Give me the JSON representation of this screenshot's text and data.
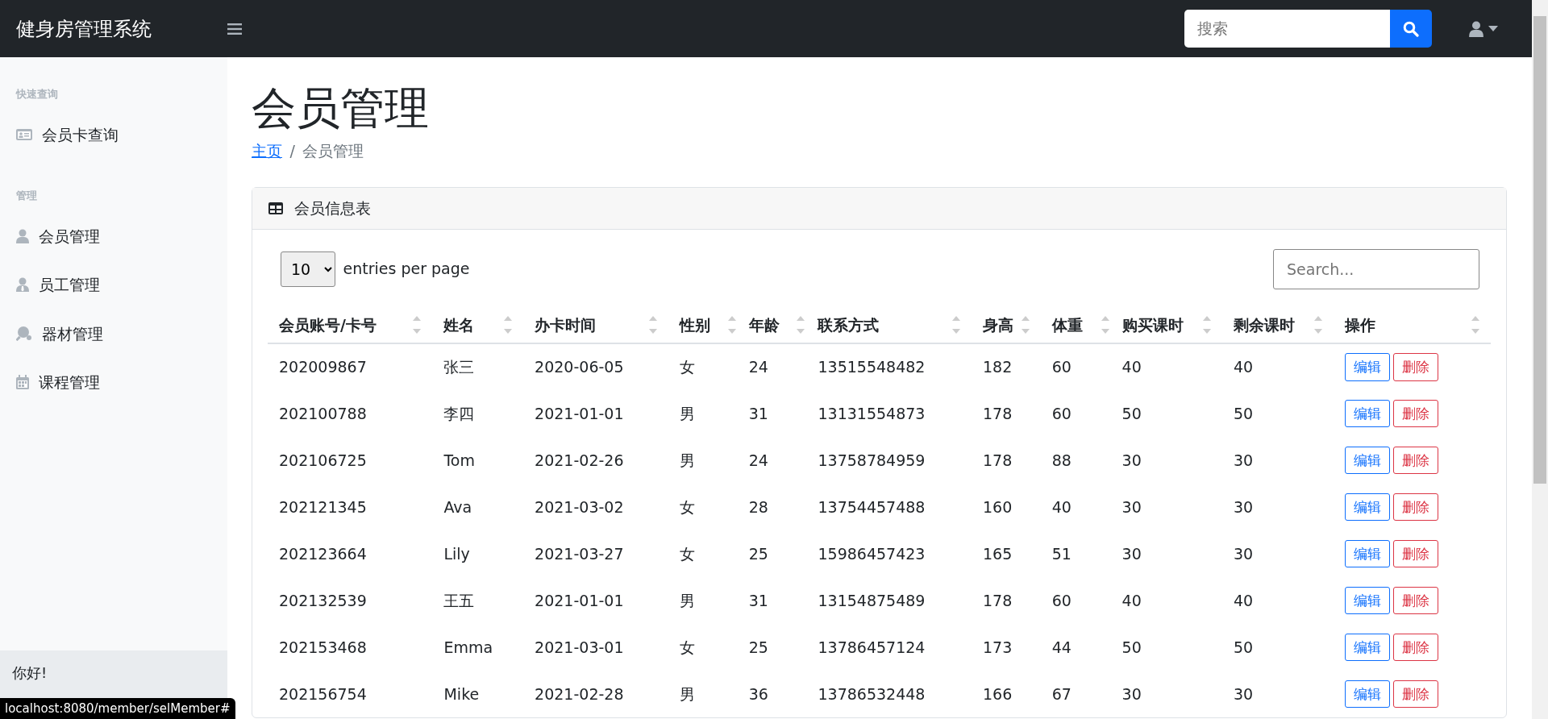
{
  "navbar": {
    "brand": "健身房管理系统",
    "search": {
      "placeholder": "搜索"
    }
  },
  "sidebar": {
    "sections": [
      {
        "heading": "快速查询",
        "items": [
          {
            "label": "会员卡查询",
            "kind": "card"
          }
        ]
      },
      {
        "heading": "管理",
        "items": [
          {
            "label": "会员管理",
            "kind": "user"
          },
          {
            "label": "员工管理",
            "kind": "staff"
          },
          {
            "label": "器材管理",
            "kind": "equipment"
          },
          {
            "label": "课程管理",
            "kind": "calendar"
          }
        ]
      }
    ],
    "footer": {
      "greeting": "你好!"
    }
  },
  "page": {
    "title": "会员管理",
    "breadcrumb_separator": "/",
    "breadcrumb": [
      {
        "label": "主页",
        "kind": "link"
      },
      {
        "label": "会员管理",
        "kind": "current"
      }
    ]
  },
  "card": {
    "title": "会员信息表",
    "page_size": "10",
    "page_size_label": "entries per page",
    "search": {
      "placeholder": "Search..."
    },
    "table": {
      "columns": [
        "会员账号/卡号",
        "姓名",
        "办卡时间",
        "性别",
        "年龄",
        "联系方式",
        "身高",
        "体重",
        "购买课时",
        "剩余课时",
        "操作"
      ],
      "rows": [
        {
          "cells": [
            "202009867",
            "张三",
            "2020-06-05",
            "女",
            "24",
            "13515548482",
            "182",
            "60",
            "40",
            "40"
          ],
          "actions": [
            {
              "label": "编辑",
              "kind": "edit"
            },
            {
              "label": "删除",
              "kind": "delete"
            }
          ]
        },
        {
          "cells": [
            "202100788",
            "李四",
            "2021-01-01",
            "男",
            "31",
            "13131554873",
            "178",
            "60",
            "50",
            "50"
          ],
          "actions": [
            {
              "label": "编辑",
              "kind": "edit"
            },
            {
              "label": "删除",
              "kind": "delete"
            }
          ]
        },
        {
          "cells": [
            "202106725",
            "Tom",
            "2021-02-26",
            "男",
            "24",
            "13758784959",
            "178",
            "88",
            "30",
            "30"
          ],
          "actions": [
            {
              "label": "编辑",
              "kind": "edit"
            },
            {
              "label": "删除",
              "kind": "delete"
            }
          ]
        },
        {
          "cells": [
            "202121345",
            "Ava",
            "2021-03-02",
            "女",
            "28",
            "13754457488",
            "160",
            "40",
            "30",
            "30"
          ],
          "actions": [
            {
              "label": "编辑",
              "kind": "edit"
            },
            {
              "label": "删除",
              "kind": "delete"
            }
          ]
        },
        {
          "cells": [
            "202123664",
            "Lily",
            "2021-03-27",
            "女",
            "25",
            "15986457423",
            "165",
            "51",
            "30",
            "30"
          ],
          "actions": [
            {
              "label": "编辑",
              "kind": "edit"
            },
            {
              "label": "删除",
              "kind": "delete"
            }
          ]
        },
        {
          "cells": [
            "202132539",
            "王五",
            "2021-01-01",
            "男",
            "31",
            "13154875489",
            "178",
            "60",
            "40",
            "40"
          ],
          "actions": [
            {
              "label": "编辑",
              "kind": "edit"
            },
            {
              "label": "删除",
              "kind": "delete"
            }
          ]
        },
        {
          "cells": [
            "202153468",
            "Emma",
            "2021-03-01",
            "女",
            "25",
            "13786457124",
            "173",
            "44",
            "50",
            "50"
          ],
          "actions": [
            {
              "label": "编辑",
              "kind": "edit"
            },
            {
              "label": "删除",
              "kind": "delete"
            }
          ]
        },
        {
          "cells": [
            "202156754",
            "Mike",
            "2021-02-28",
            "男",
            "36",
            "13786532448",
            "166",
            "67",
            "30",
            "30"
          ],
          "actions": [
            {
              "label": "编辑",
              "kind": "edit"
            },
            {
              "label": "删除",
              "kind": "delete"
            }
          ]
        }
      ]
    }
  },
  "status_bar": {
    "url": "localhost:8080/member/selMember#"
  }
}
